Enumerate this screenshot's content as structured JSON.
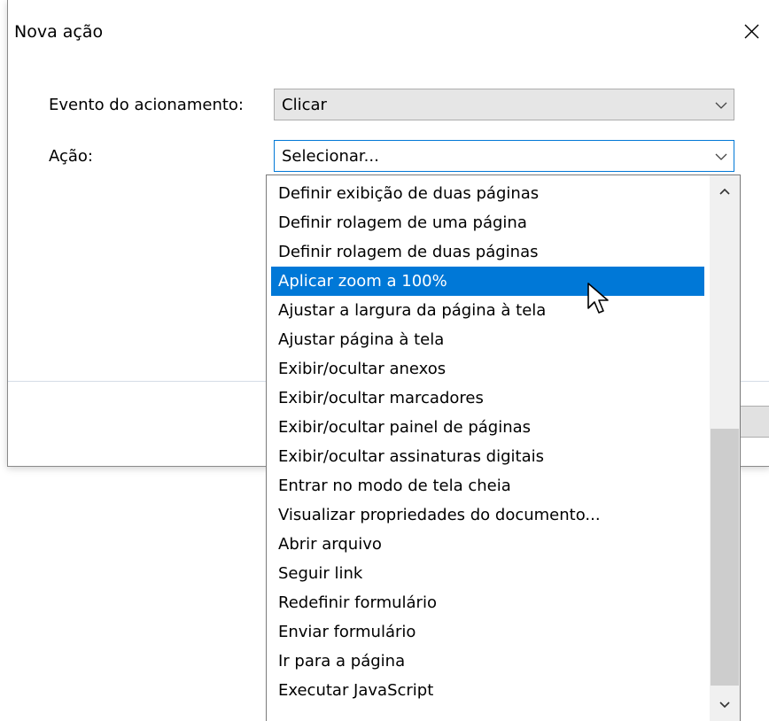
{
  "dialog": {
    "title": "Nova ação",
    "event_label": "Evento do acionamento:",
    "event_value": "Clicar",
    "action_label": "Ação:",
    "action_value": "Selecionar..."
  },
  "icons": {
    "close": "close-icon",
    "dropdown": "chevron-down-icon",
    "scroll_up": "chevron-up-icon",
    "cursor": "mouse-pointer-icon"
  },
  "colors": {
    "selection": "#0078d7",
    "combo_focus_border": "#0078d7",
    "scrollbar_track": "#f0f0f0",
    "scrollbar_thumb": "#cdcdcd"
  },
  "dropdown": {
    "selected_index": 3,
    "items": [
      "Definir exibição de duas páginas",
      "Definir rolagem de uma página",
      "Definir rolagem de duas páginas",
      "Aplicar zoom a 100%",
      "Ajustar a largura da página à tela",
      "Ajustar página à tela",
      "Exibir/ocultar anexos",
      "Exibir/ocultar marcadores",
      "Exibir/ocultar painel de páginas",
      "Exibir/ocultar assinaturas digitais",
      "Entrar no modo de tela cheia",
      "Visualizar propriedades do documento...",
      "Abrir arquivo",
      "Seguir link",
      "Redefinir formulário",
      "Enviar formulário",
      "Ir para a página",
      "Executar JavaScript"
    ]
  }
}
